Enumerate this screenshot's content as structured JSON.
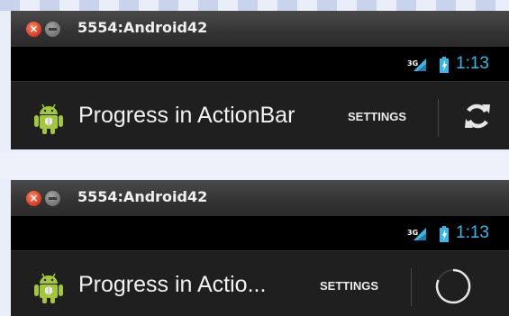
{
  "emulator_windows": [
    {
      "title": "5554:Android42",
      "status_bar": {
        "network": "3G",
        "clock": "1:13"
      },
      "action_bar": {
        "app_title": "Progress in ActionBar",
        "settings_label": "SETTINGS",
        "action_icon": "refresh-icon"
      }
    },
    {
      "title": "5554:Android42",
      "status_bar": {
        "network": "3G",
        "clock": "1:13"
      },
      "action_bar": {
        "app_title": "Progress in Actio...",
        "settings_label": "SETTINGS",
        "action_icon": "progress-spinner"
      }
    }
  ],
  "colors": {
    "clock_blue": "#39b7e5",
    "action_bar_bg": "#1f1f1f",
    "status_bar_bg": "#000000",
    "close_button": "#e2452a",
    "android_green": "#a4c639"
  }
}
